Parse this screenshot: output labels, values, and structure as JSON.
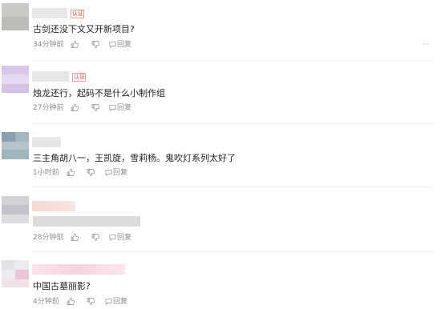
{
  "comments": [
    {
      "badge": "认证",
      "text": "古剑还没下文又开新项目?",
      "time": "34分钟前",
      "reply_label": "回复",
      "more": "···"
    },
    {
      "badge": "认证",
      "text": "烛龙还行，起码不是什么小制作组",
      "time": "27分钟前",
      "reply_label": "回复"
    },
    {
      "text": "三主角胡八一，王凯旋，雪莉杨。鬼吹灯系列太好了",
      "time": "1小时前",
      "reply_label": "回复"
    },
    {
      "text": "",
      "time": "28分钟前",
      "reply_label": "回复"
    },
    {
      "text": "中国古墓丽影?",
      "time": "4分钟前",
      "reply_label": "回复"
    }
  ],
  "icons": {
    "like": "thumbs-up-icon",
    "dislike": "thumbs-down-icon",
    "reply": "reply-icon",
    "more": "more-icon"
  },
  "colors": {
    "badge": "#e8433a",
    "meta_text": "#8c8c8c",
    "divider": "#efefef"
  }
}
